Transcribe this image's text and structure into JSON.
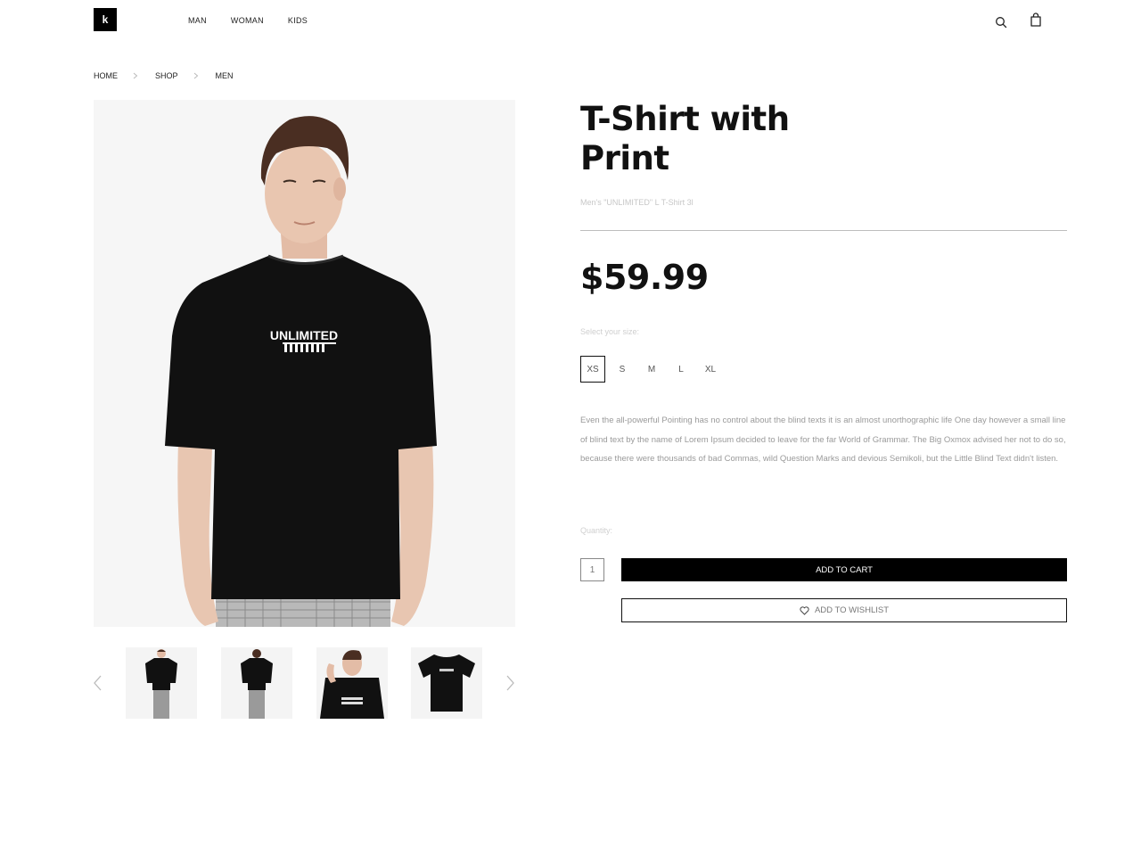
{
  "header": {
    "logo": "k",
    "nav": [
      "MAN",
      "WOMAN",
      "KIDS"
    ],
    "icons": [
      "search-icon",
      "shopping-bag-icon"
    ]
  },
  "breadcrumb": [
    "HOME",
    "SHOP",
    "MEN"
  ],
  "gallery": {
    "main_image": "model wearing black t-shirt",
    "shirt_print": "UNLIMITED",
    "thumbnails": [
      "front view",
      "back view",
      "close-up",
      "flat lay"
    ],
    "icons": [
      "chevron-left-icon",
      "chevron-right-icon"
    ]
  },
  "product": {
    "title_line1": "T-Shirt with",
    "title_line2": "Print",
    "subtitle": "Men's \"UNLIMITED\" L T-Shirt 3l",
    "price": "$59.99",
    "size_label": "Select your size:",
    "sizes": [
      "XS",
      "S",
      "M",
      "L",
      "XL"
    ],
    "selected_size": "XS",
    "description": "Even the all-powerful Pointing has no control about the blind texts it is an almost unorthographic life One day however a small line of blind text by the name of Lorem Ipsum decided to leave for the far World of Grammar. The Big Oxmox advised her not to do so, because there were thousands of bad Commas, wild Question Marks and devious Semikoli, but the Little Blind Text didn't listen.",
    "quantity_label": "Quantity:",
    "quantity": "1",
    "add_to_cart": "ADD TO CART",
    "add_to_wishlist": "ADD TO WISHLIST"
  },
  "colors": {
    "primary": "#000000",
    "background": "#ffffff",
    "muted_text": "#9a9a9a"
  }
}
